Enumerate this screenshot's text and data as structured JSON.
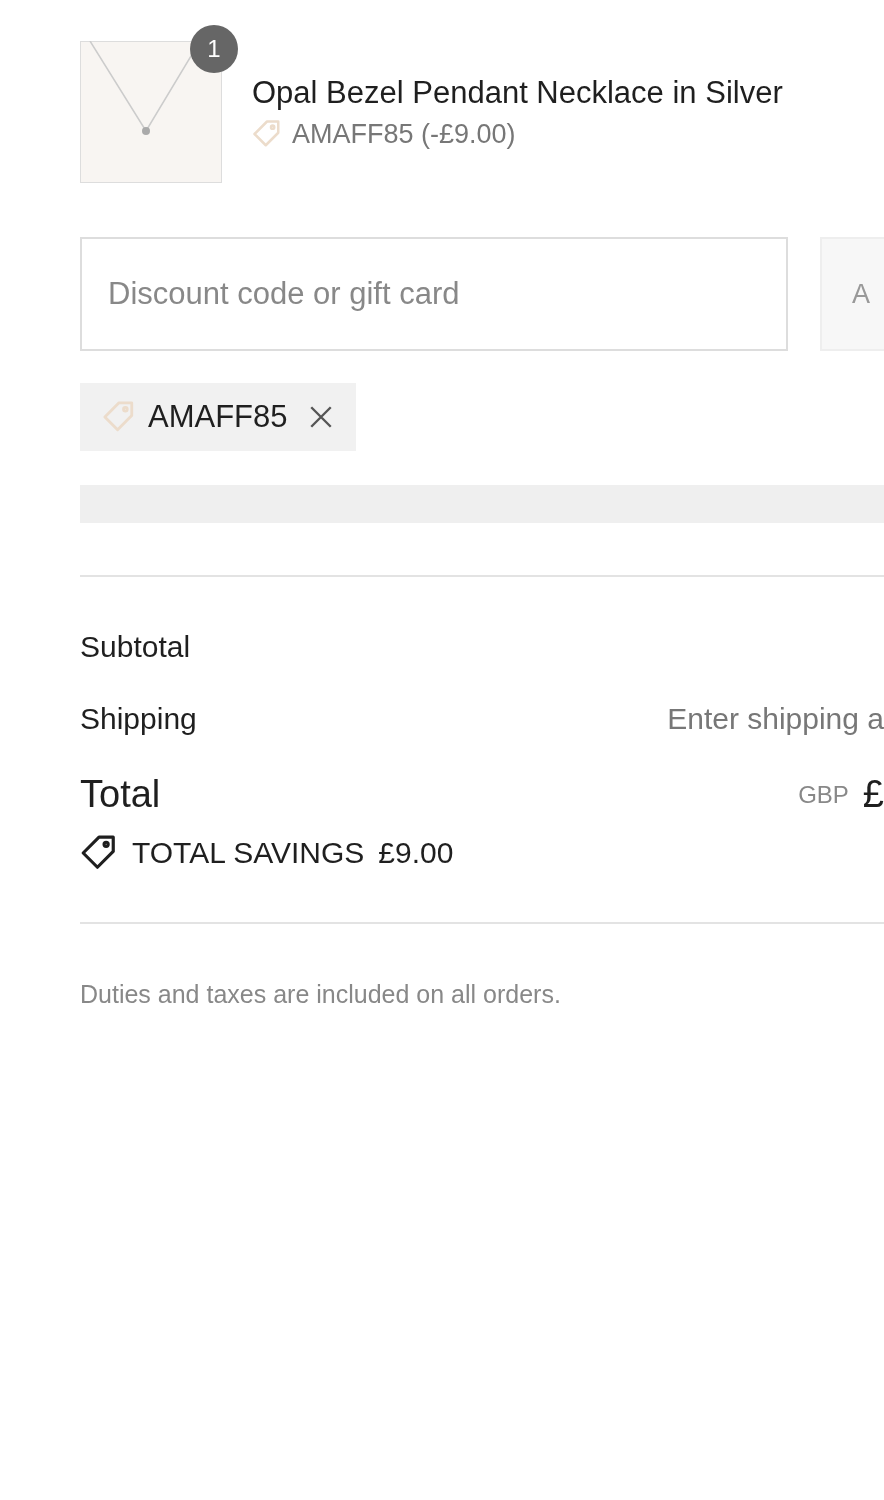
{
  "line_item": {
    "quantity": "1",
    "name": "Opal Bezel Pendant Necklace in Silver",
    "discount": "AMAFF85 (-£9.00)"
  },
  "discount_form": {
    "placeholder": "Discount code or gift card",
    "button": "A"
  },
  "applied_codes": [
    {
      "code": "AMAFF85"
    }
  ],
  "summary": {
    "rows": [
      {
        "label": "Subtotal",
        "value": ""
      },
      {
        "label": "Shipping",
        "value": "Enter shipping a"
      }
    ],
    "total": {
      "label": "Total",
      "currency": "GBP",
      "amount": "£"
    },
    "savings": {
      "label": "TOTAL SAVINGS",
      "amount": "£9.00"
    }
  },
  "note": "Duties and taxes are included on all orders."
}
